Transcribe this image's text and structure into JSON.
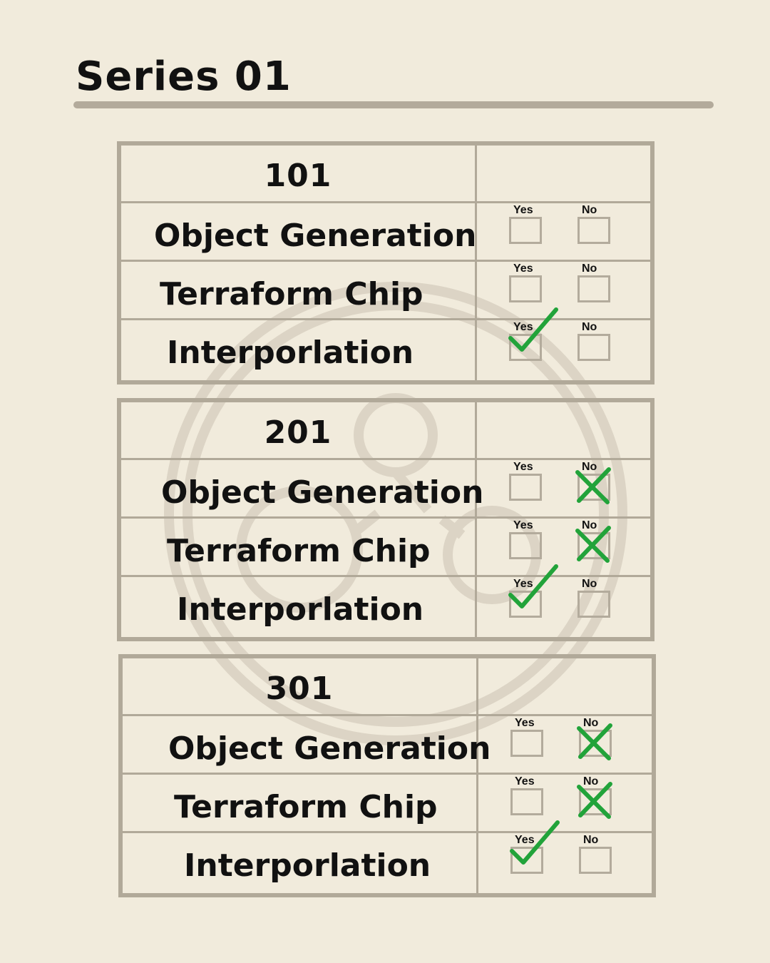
{
  "title": "Series 01",
  "answer_labels": {
    "yes": "Yes",
    "no": "No"
  },
  "colors": {
    "background": "#f1ebdc",
    "rule": "#b3aa9b",
    "mark": "#22a33a"
  },
  "tables": [
    {
      "heading": "101",
      "rows": [
        {
          "label": "Object Generation",
          "answer": null
        },
        {
          "label": "Terraform Chip",
          "answer": null
        },
        {
          "label": "Interporlation",
          "answer": "yes"
        }
      ]
    },
    {
      "heading": "201",
      "rows": [
        {
          "label": "Object Generation",
          "answer": "no"
        },
        {
          "label": "Terraform Chip",
          "answer": "no"
        },
        {
          "label": "Interporlation",
          "answer": "yes"
        }
      ]
    },
    {
      "heading": "301",
      "rows": [
        {
          "label": "Object Generation",
          "answer": "no"
        },
        {
          "label": "Terraform Chip",
          "answer": "no"
        },
        {
          "label": "Interporlation",
          "answer": "yes"
        }
      ]
    }
  ]
}
